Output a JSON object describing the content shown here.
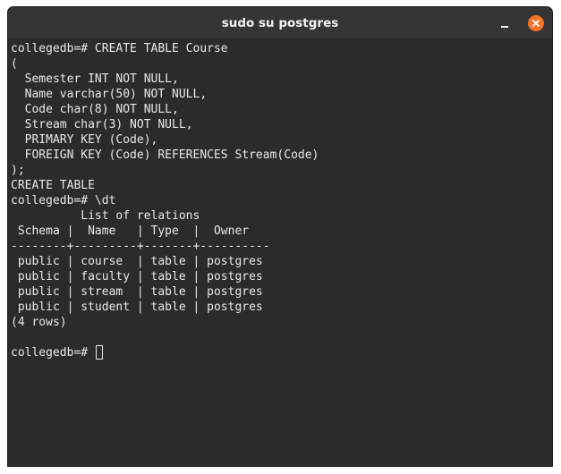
{
  "window": {
    "title": "sudo su postgres",
    "minimize_icon": "minimize-icon",
    "close_icon": "close-icon",
    "close_color": "#f37329"
  },
  "terminal": {
    "lines": [
      "collegedb=# CREATE TABLE Course",
      "(",
      "  Semester INT NOT NULL,",
      "  Name varchar(50) NOT NULL,",
      "  Code char(8) NOT NULL,",
      "  Stream char(3) NOT NULL,",
      "  PRIMARY KEY (Code),",
      "  FOREIGN KEY (Code) REFERENCES Stream(Code)",
      ");",
      "CREATE TABLE",
      "collegedb=# \\dt",
      "          List of relations",
      " Schema |  Name   | Type  |  Owner",
      "--------+---------+-------+----------",
      " public | course  | table | postgres",
      " public | faculty | table | postgres",
      " public | stream  | table | postgres",
      " public | student | table | postgres",
      "(4 rows)",
      "",
      "collegedb=# "
    ]
  }
}
